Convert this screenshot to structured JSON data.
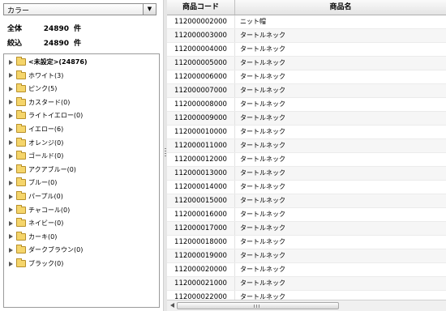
{
  "filter": {
    "dropdown_value": "カラー"
  },
  "stats": {
    "total_label": "全体",
    "total_value": "24890",
    "total_unit": "件",
    "filtered_label": "絞込",
    "filtered_value": "24890",
    "filtered_unit": "件"
  },
  "tree": {
    "items": [
      {
        "label": "<未設定>(24876)"
      },
      {
        "label": "ホワイト(3)"
      },
      {
        "label": "ピンク(5)"
      },
      {
        "label": "カスタード(0)"
      },
      {
        "label": "ライトイエロー(0)"
      },
      {
        "label": "イエロー(6)"
      },
      {
        "label": "オレンジ(0)"
      },
      {
        "label": "ゴールド(0)"
      },
      {
        "label": "アクアブルー(0)"
      },
      {
        "label": "ブルー(0)"
      },
      {
        "label": "パープル(0)"
      },
      {
        "label": "チャコール(0)"
      },
      {
        "label": "ネイビー(0)"
      },
      {
        "label": "カーキ(0)"
      },
      {
        "label": "ダークブラウン(0)"
      },
      {
        "label": "ブラック(0)"
      }
    ]
  },
  "grid": {
    "columns": [
      "商品コード",
      "商品名"
    ],
    "rows": [
      {
        "code": "112000002000",
        "name": "ニット帽"
      },
      {
        "code": "112000003000",
        "name": "タートルネック"
      },
      {
        "code": "112000004000",
        "name": "タートルネック"
      },
      {
        "code": "112000005000",
        "name": "タートルネック"
      },
      {
        "code": "112000006000",
        "name": "タートルネック"
      },
      {
        "code": "112000007000",
        "name": "タートルネック"
      },
      {
        "code": "112000008000",
        "name": "タートルネック"
      },
      {
        "code": "112000009000",
        "name": "タートルネック"
      },
      {
        "code": "112000010000",
        "name": "タートルネック"
      },
      {
        "code": "112000011000",
        "name": "タートルネック"
      },
      {
        "code": "112000012000",
        "name": "タートルネック"
      },
      {
        "code": "112000013000",
        "name": "タートルネック"
      },
      {
        "code": "112000014000",
        "name": "タートルネック"
      },
      {
        "code": "112000015000",
        "name": "タートルネック"
      },
      {
        "code": "112000016000",
        "name": "タートルネック"
      },
      {
        "code": "112000017000",
        "name": "タートルネック"
      },
      {
        "code": "112000018000",
        "name": "タートルネック"
      },
      {
        "code": "112000019000",
        "name": "タートルネック"
      },
      {
        "code": "112000020000",
        "name": "タートルネック"
      },
      {
        "code": "112000021000",
        "name": "タートルネック"
      },
      {
        "code": "112000022000",
        "name": "タートルネック"
      }
    ]
  },
  "icons": {
    "dropdown": "chevron-down-icon",
    "tree_expand": "triangle-right-icon",
    "tree_folder": "folder-icon",
    "scroll_left": "arrow-left-icon"
  }
}
